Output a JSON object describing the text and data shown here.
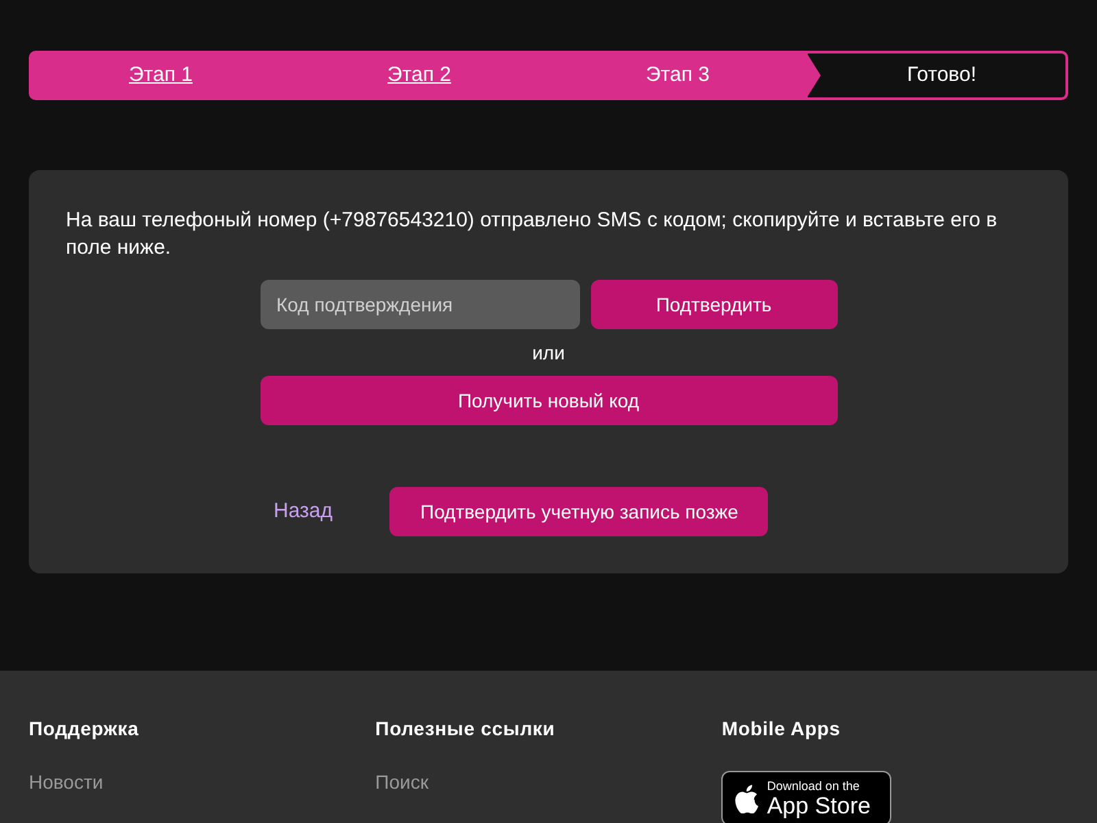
{
  "steps": [
    {
      "label": "Этап 1",
      "completed": true,
      "selected": false
    },
    {
      "label": "Этап 2",
      "completed": true,
      "selected": false
    },
    {
      "label": "Этап 3",
      "completed": true,
      "selected": true
    },
    {
      "label": "Готово!",
      "completed": false,
      "selected": false
    }
  ],
  "card": {
    "message": "На ваш телефоный номер (+79876543210) отправлено SMS с кодом; скопируйте и вставьте его в поле ниже.",
    "code_field": {
      "placeholder": "Код подтверждения"
    },
    "confirm_button": "Подтвердить",
    "or_text": "или",
    "new_code_button": "Получить новый код",
    "back_link": "Назад",
    "later_button": "Подтвердить учетную запись позже"
  },
  "footer": {
    "columns": [
      {
        "title": "Поддержка",
        "links": [
          "Новости"
        ]
      },
      {
        "title": "Полезные ссылки",
        "links": [
          "Поиск"
        ]
      },
      {
        "title": "Mobile Apps",
        "badge": {
          "small": "Download on the",
          "big": "App Store"
        }
      }
    ]
  }
}
